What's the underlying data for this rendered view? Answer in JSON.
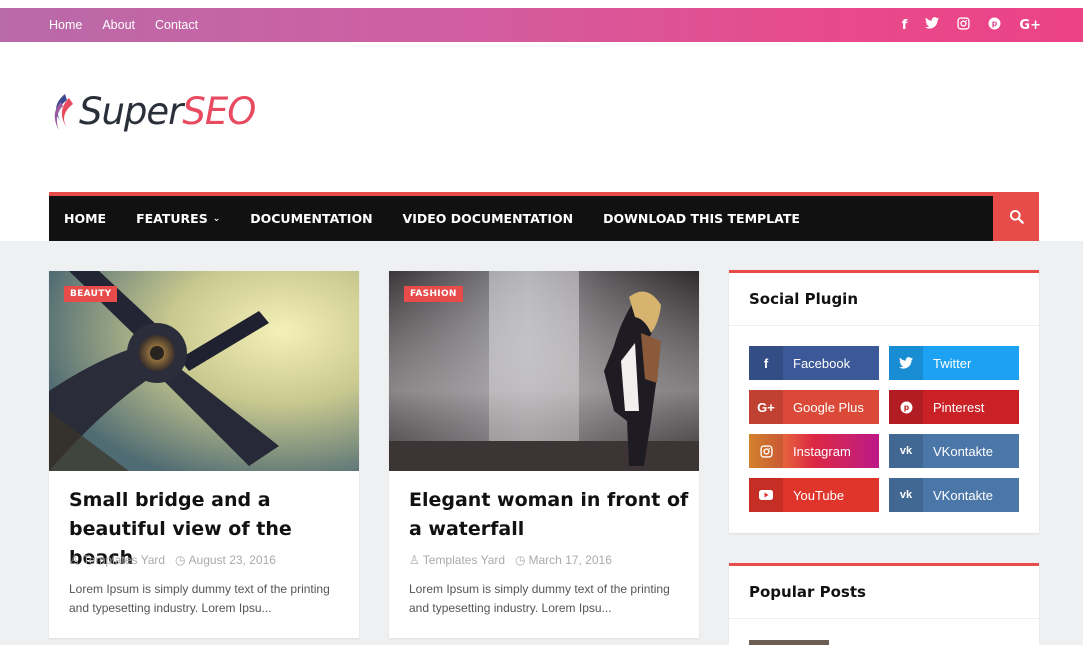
{
  "topbar": {
    "links": [
      "Home",
      "About",
      "Contact"
    ],
    "social_icons": [
      "facebook-icon",
      "twitter-icon",
      "instagram-icon",
      "pinterest-icon",
      "google-plus-icon"
    ]
  },
  "logo": {
    "part1": "Super",
    "part2": "SEO"
  },
  "mainnav": {
    "items": [
      "HOME",
      "FEATURES",
      "DOCUMENTATION",
      "VIDEO DOCUMENTATION",
      "DOWNLOAD THIS TEMPLATE"
    ],
    "accent": "#e84c4a"
  },
  "posts": [
    {
      "badge": "BEAUTY",
      "title": "Small bridge and a beautiful view of the beach",
      "author": "Templates Yard",
      "date": "August 23, 2016",
      "excerpt": "Lorem Ipsum is simply dummy text of the printing and typesetting industry. Lorem Ipsu..."
    },
    {
      "badge": "FASHION",
      "title": "Elegant woman in front of a waterfall",
      "author": "Templates Yard",
      "date": "March 17, 2016",
      "excerpt": "Lorem Ipsum is simply dummy text of the printing and typesetting industry. Lorem Ipsu..."
    }
  ],
  "sidebar": {
    "social_title": "Social Plugin",
    "social": [
      {
        "label": "Facebook",
        "icon": "facebook-icon",
        "color": "#3b5998"
      },
      {
        "label": "Twitter",
        "icon": "twitter-icon",
        "color": "#1da1f2"
      },
      {
        "label": "Google Plus",
        "icon": "google-plus-icon",
        "color": "#db4a39"
      },
      {
        "label": "Pinterest",
        "icon": "pinterest-icon",
        "color": "#ca2127"
      },
      {
        "label": "Instagram",
        "icon": "instagram-icon",
        "color": "#dc2743"
      },
      {
        "label": "VKontakte",
        "icon": "vk-icon",
        "color": "#4a76a8"
      },
      {
        "label": "YouTube",
        "icon": "youtube-icon",
        "color": "#e0352b"
      },
      {
        "label": "VKontakte",
        "icon": "vk-icon",
        "color": "#4a76a8"
      }
    ],
    "popular_title": "Popular Posts"
  }
}
